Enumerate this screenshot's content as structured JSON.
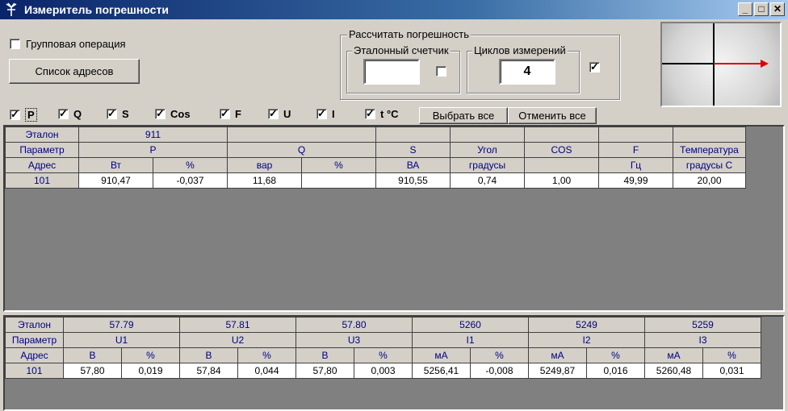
{
  "window": {
    "title": "Измеритель погрешности",
    "icon": "antenna-icon",
    "buttons": {
      "minimize": "_",
      "maximize": "□",
      "close": "✕"
    }
  },
  "controls": {
    "group_operation": {
      "label": "Групповая операция",
      "checked": false
    },
    "address_list_button": "Список адресов",
    "calc_group": {
      "label": "Рассчитать погрешность",
      "reference_meter": {
        "label": "Эталонный счетчик",
        "value": "",
        "checked": false
      },
      "cycles": {
        "label": "Циклов измерений",
        "value": "4",
        "checked": true
      }
    },
    "params": [
      {
        "label": "P",
        "checked": true
      },
      {
        "label": "Q",
        "checked": true
      },
      {
        "label": "S",
        "checked": true
      },
      {
        "label": "Cos",
        "checked": true
      },
      {
        "label": "F",
        "checked": true
      },
      {
        "label": "U",
        "checked": true
      },
      {
        "label": "I",
        "checked": true
      },
      {
        "label": "t °C",
        "checked": true
      }
    ],
    "select_all": "Выбрать все",
    "deselect_all": "Отменить все"
  },
  "top_table": {
    "etalon": {
      "label": "Эталон",
      "value": "911"
    },
    "param_row": {
      "label": "Параметр",
      "p": "P",
      "q": "Q",
      "s": "S",
      "angle": "Угол",
      "cos": "COS",
      "f": "F",
      "temp": "Температура"
    },
    "units_row": {
      "label": "Адрес",
      "p_unit": "Вт",
      "p_pct": "%",
      "q_unit": "вар",
      "q_pct": "%",
      "s_unit": "ВА",
      "angle_unit": "градусы",
      "cos_unit": "",
      "f_unit": "Гц",
      "temp_unit": "градусы С"
    },
    "rows": [
      {
        "addr": "101",
        "p": "910,47",
        "p_pct": "-0,037",
        "q": "11,68",
        "q_pct": "",
        "s": "910,55",
        "angle": "0,74",
        "cos": "1,00",
        "f": "49,99",
        "temp": "20,00"
      }
    ]
  },
  "bottom_table": {
    "etalon": {
      "label": "Эталон",
      "u1": "57.79",
      "u2": "57.81",
      "u3": "57.80",
      "i1": "5260",
      "i2": "5249",
      "i3": "5259"
    },
    "param_row": {
      "label": "Параметр",
      "u1": "U1",
      "u2": "U2",
      "u3": "U3",
      "i1": "I1",
      "i2": "I2",
      "i3": "I3"
    },
    "units_row": {
      "label": "Адрес",
      "v": "В",
      "pct": "%",
      "ma": "мА"
    },
    "rows": [
      {
        "addr": "101",
        "u1": "57,80",
        "u1_pct": "0,019",
        "u2": "57,84",
        "u2_pct": "0,044",
        "u3": "57,80",
        "u3_pct": "0,003",
        "i1": "5256,41",
        "i1_pct": "-0,008",
        "i2": "5249,87",
        "i2_pct": "0,016",
        "i3": "5260,48",
        "i3_pct": "0,031"
      }
    ]
  },
  "colors": {
    "titlebar": "#0a246a",
    "header_text": "#000080",
    "arrow": "#e00000"
  }
}
